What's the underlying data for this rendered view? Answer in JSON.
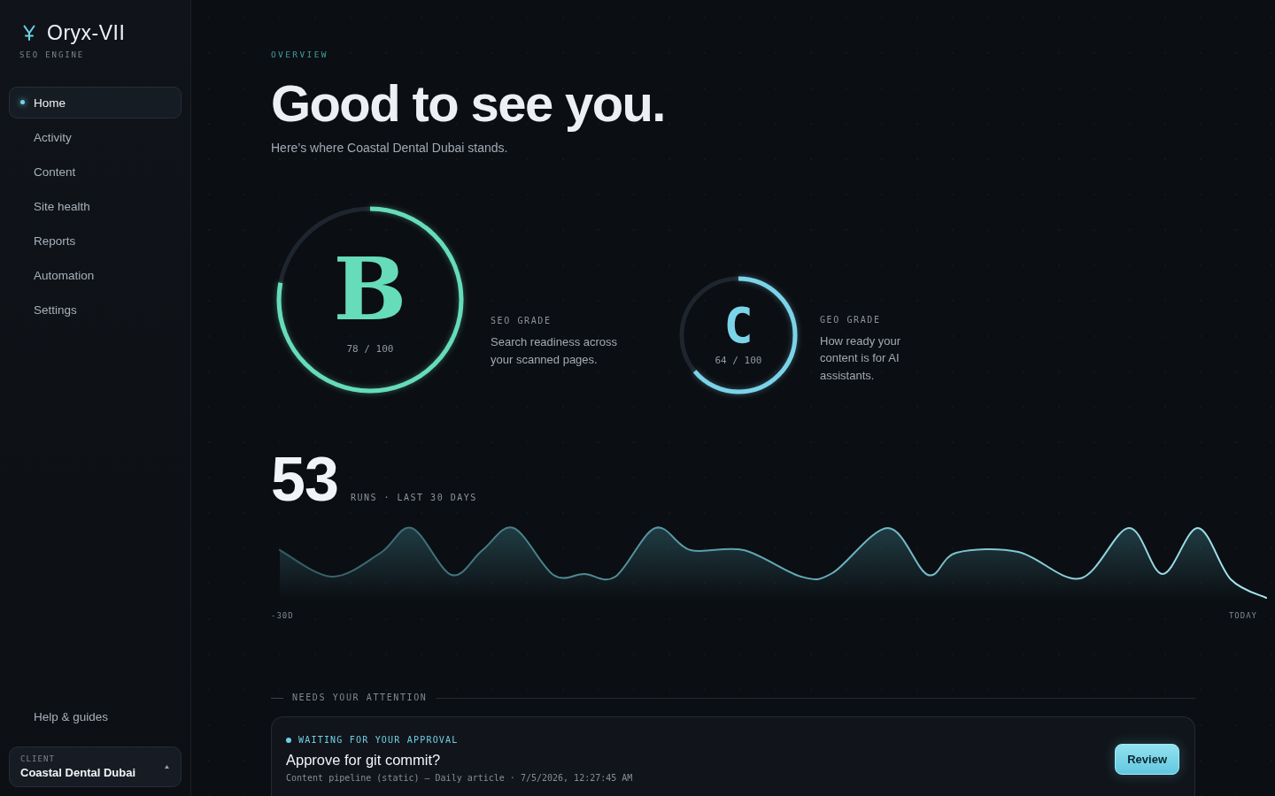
{
  "sidebar": {
    "brand": {
      "name": "Oryx-VII",
      "tagline": "SEO ENGINE"
    },
    "nav": [
      {
        "label": "Home",
        "selected": true
      },
      {
        "label": "Activity",
        "selected": false
      },
      {
        "label": "Content",
        "selected": false
      },
      {
        "label": "Site health",
        "selected": false
      },
      {
        "label": "Reports",
        "selected": false
      },
      {
        "label": "Automation",
        "selected": false
      },
      {
        "label": "Settings",
        "selected": false
      }
    ],
    "help": "Help & guides",
    "client": {
      "label": "CLIENT",
      "name": "Coastal Dental Dubai"
    }
  },
  "header": {
    "eyebrow": "OVERVIEW",
    "title": "Good to see you.",
    "subtitle": "Here’s where Coastal Dental Dubai stands."
  },
  "grades": [
    {
      "kind": "large",
      "letter": "B",
      "score": "78 / 100",
      "level": 0.78,
      "color": "#66dcb9",
      "label": "SEO GRADE",
      "description": "Search readiness across your scanned pages."
    },
    {
      "kind": "small",
      "letter": "C",
      "score": "64 / 100",
      "level": 0.64,
      "color": "#7bd3e9",
      "label": "GEO GRADE",
      "description": "How ready your content is for AI assistants."
    }
  ],
  "runs": {
    "count": "53",
    "caption": "RUNS · LAST 30 DAYS",
    "axis_start": "-30D",
    "axis_end": "TODAY"
  },
  "attention": {
    "heading": "NEEDS YOUR ATTENTION",
    "items": [
      {
        "status": "WAITING FOR YOUR APPROVAL",
        "title": "Approve for git commit?",
        "meta": "Content pipeline (static) — Daily article · 7/5/2026, 12:27:45 AM",
        "action": "Review"
      }
    ]
  }
}
